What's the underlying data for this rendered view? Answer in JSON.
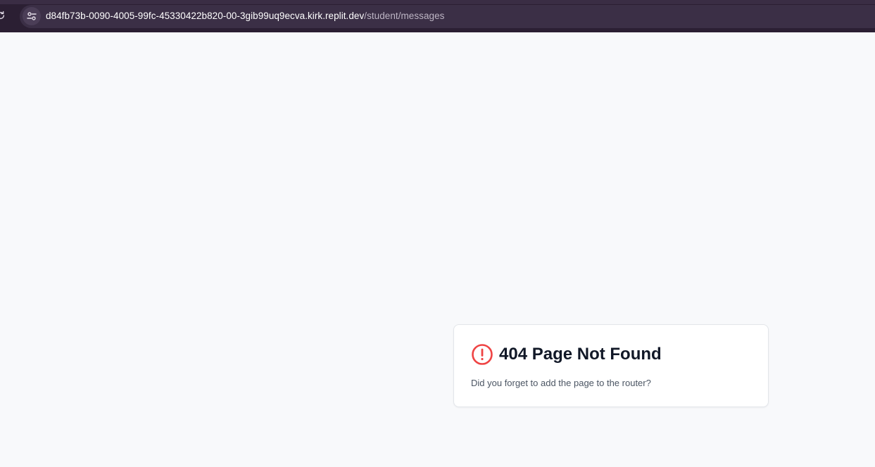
{
  "browser": {
    "url_host": "d84fb73b-0090-4005-99fc-45330422b820-00-3gib99uq9ecva.kirk.replit.dev",
    "url_path": "/student/messages",
    "icons": [
      "reload-icon",
      "site-info-icon"
    ],
    "colors": {
      "toolbar": "#2b1f33",
      "omnibox": "#3b2f46"
    }
  },
  "not_found": {
    "title": "404 Page Not Found",
    "message": "Did you forget to add the page to the router?",
    "icon": "alert-circle-icon",
    "accent_color": "#ef4444"
  }
}
